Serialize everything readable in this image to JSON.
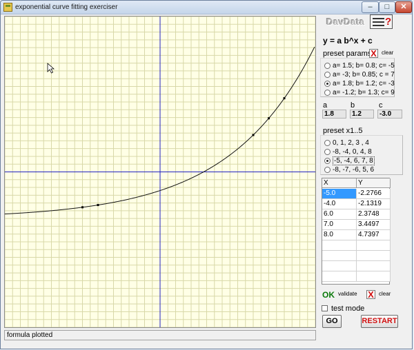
{
  "window": {
    "title": "exponential curve fitting exerciser",
    "minimize": "–",
    "maximize": "□",
    "close": "✕"
  },
  "logo": "DavData",
  "help": {
    "symbol": "?"
  },
  "formula": "y = a b^x + c",
  "preset_params": {
    "label": "preset params",
    "clear_label": "clear",
    "clear_icon": "X",
    "options": [
      "a= 1.5; b= 0.8; c= -5",
      "a= -3; b= 0.85; c = 7",
      "a= 1.8; b= 1.2; c= -3",
      "a= -1.2; b= 1.3; c= 9"
    ],
    "selected_index": 2
  },
  "params": {
    "a": {
      "label": "a",
      "value": "1.8"
    },
    "b": {
      "label": "b",
      "value": "1.2"
    },
    "c": {
      "label": "c",
      "value": "-3.0"
    }
  },
  "preset_x": {
    "label": "preset x1..5",
    "options": [
      "0, 1, 2, 3 , 4",
      "-8, -4, 0, 4, 8",
      "-5, -4, 6, 7, 8",
      "-8, -7, -6, 5, 6"
    ],
    "selected_index": 2
  },
  "table": {
    "columns": [
      "X",
      "Y"
    ],
    "rows": [
      [
        "-5.0",
        "-2.2766"
      ],
      [
        "-4.0",
        "-2.1319"
      ],
      [
        "6.0",
        "2.3748"
      ],
      [
        "7.0",
        "3.4497"
      ],
      [
        "8.0",
        "4.7397"
      ]
    ],
    "selected_row": 0
  },
  "actions": {
    "ok": "OK",
    "validate": "validate",
    "clear": "clear",
    "clear_icon": "X",
    "test_mode": "test mode",
    "go": "GO",
    "restart": "RESTART"
  },
  "status": "formula plotted",
  "colors": {
    "grid": "#d8d8a8",
    "axis": "#2020c0",
    "curve": "#111111",
    "background": "#ffffe6",
    "restart": "#d01010",
    "ok": "#0a7a0a"
  },
  "chart_data": {
    "type": "line",
    "xlim": [
      -10,
      10
    ],
    "ylim": [
      -10,
      10
    ],
    "function": "y = 1.8 * 1.2^x - 3",
    "points": [
      {
        "x": -5,
        "y": -2.2766
      },
      {
        "x": -4,
        "y": -2.1319
      },
      {
        "x": 6,
        "y": 2.3748
      },
      {
        "x": 7,
        "y": 3.4497
      },
      {
        "x": 8,
        "y": 4.7397
      }
    ],
    "grid": true
  }
}
